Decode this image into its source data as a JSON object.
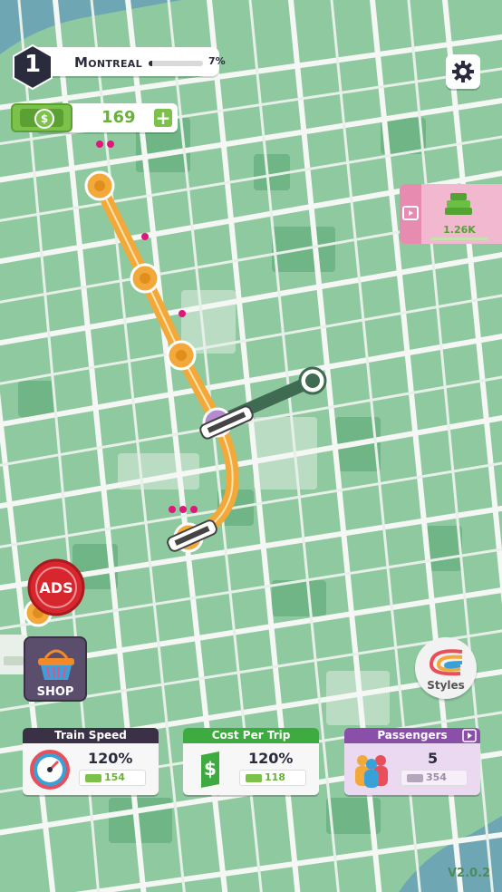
{
  "header": {
    "level": "1",
    "city": "Montreal",
    "progress_percent": 7,
    "progress_label": "7%"
  },
  "wallet": {
    "amount": "169",
    "add_label": "+"
  },
  "offer": {
    "reward": "1.26K"
  },
  "buttons": {
    "ads_label": "ADS",
    "shop_label": "SHOP",
    "styles_label": "Styles"
  },
  "upgrades": [
    {
      "title": "Train Speed",
      "value": "120%",
      "cost": "154",
      "color": "#3a3146"
    },
    {
      "title": "Cost Per Trip",
      "value": "120%",
      "cost": "118",
      "color": "#3dab3f"
    },
    {
      "title": "Passengers",
      "value": "5",
      "cost": "354",
      "color": "#8a4fa8"
    }
  ],
  "version": "V2.0.2",
  "colors": {
    "map_bg": "#8fc9a0",
    "street": "#f4f7f4",
    "line_orange": "#f2a93a",
    "line_green": "#3f6b52",
    "passenger_dot": "#e0177a"
  }
}
